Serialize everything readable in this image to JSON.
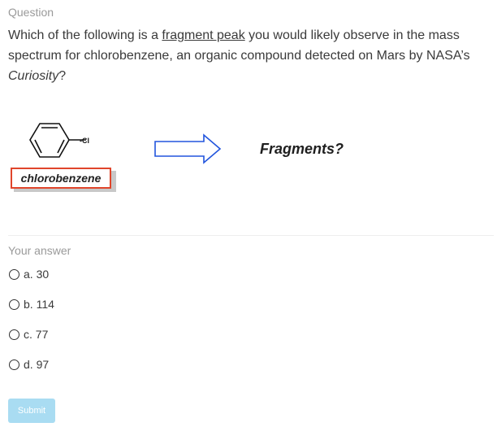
{
  "question": {
    "label": "Question",
    "text_before": "Which of the following is a ",
    "text_link": "fragment peak",
    "text_mid": " you would likely observe in the mass spectrum for chlorobenzene, an organic compound detected on Mars by NASA’s ",
    "text_italic": "Curiosity",
    "text_after": "?"
  },
  "figure": {
    "substituent": "-Cl",
    "compound_name": "chlorobenzene",
    "fragments_label": "Fragments?",
    "arrow_color": "#2255dd",
    "label_border_color": "#e0452b"
  },
  "answers": {
    "label": "Your answer",
    "options": [
      {
        "text": "a. 30"
      },
      {
        "text": "b. 114"
      },
      {
        "text": "c. 77"
      },
      {
        "text": "d. 97"
      }
    ]
  },
  "submit": {
    "label": "Submit",
    "color": "#a9dcf2"
  }
}
